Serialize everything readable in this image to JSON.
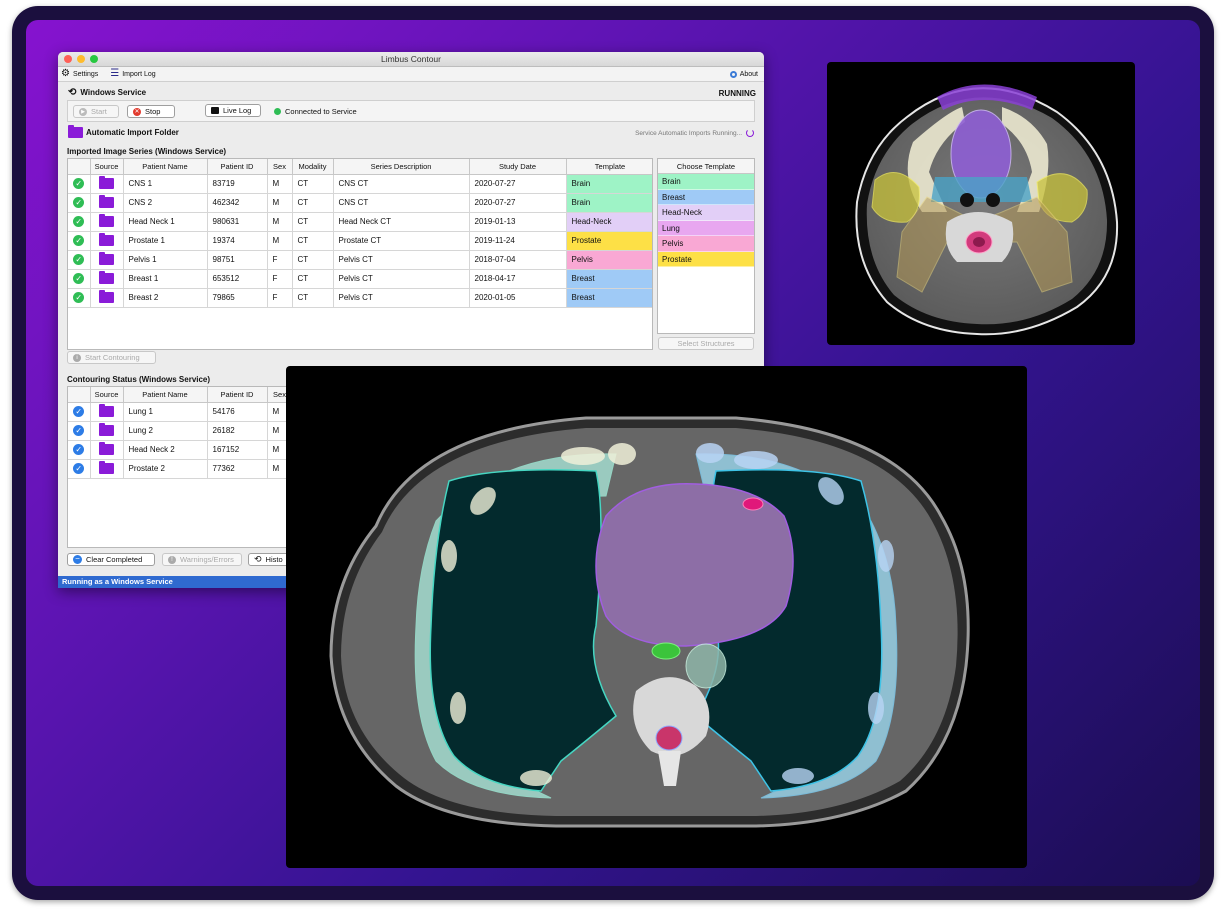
{
  "window": {
    "title": "Limbus Contour"
  },
  "menu": {
    "settings": "Settings",
    "import_log": "Import Log",
    "about": "About"
  },
  "service": {
    "heading": "Windows Service",
    "state": "RUNNING",
    "start_label": "Start",
    "stop_label": "Stop",
    "live_log_label": "Live Log",
    "connection_status": "Connected to Service"
  },
  "auto_import": {
    "label": "Automatic Import Folder",
    "status": "Service Automatic Imports Running..."
  },
  "imported": {
    "heading": "Imported Image Series (Windows Service)",
    "columns": [
      "Source",
      "Patient Name",
      "Patient ID",
      "Sex",
      "Modality",
      "Series Description",
      "Study Date",
      "Template"
    ],
    "rows": [
      {
        "name": "CNS 1",
        "id": "83719",
        "sex": "M",
        "modality": "CT",
        "desc": "CNS CT",
        "date": "2020-07-27",
        "template": "Brain",
        "color": "#9ef3c6"
      },
      {
        "name": "CNS 2",
        "id": "462342",
        "sex": "M",
        "modality": "CT",
        "desc": "CNS CT",
        "date": "2020-07-27",
        "template": "Brain",
        "color": "#9ef3c6"
      },
      {
        "name": "Head Neck 1",
        "id": "980631",
        "sex": "M",
        "modality": "CT",
        "desc": "Head Neck CT",
        "date": "2019-01-13",
        "template": "Head-Neck",
        "color": "#e2cff7"
      },
      {
        "name": "Prostate 1",
        "id": "19374",
        "sex": "M",
        "modality": "CT",
        "desc": "Prostate CT",
        "date": "2019-11-24",
        "template": "Prostate",
        "color": "#fde046"
      },
      {
        "name": "Pelvis 1",
        "id": "98751",
        "sex": "F",
        "modality": "CT",
        "desc": "Pelvis CT",
        "date": "2018-07-04",
        "template": "Pelvis",
        "color": "#f9a8d4"
      },
      {
        "name": "Breast 1",
        "id": "653512",
        "sex": "F",
        "modality": "CT",
        "desc": "Pelvis CT",
        "date": "2018-04-17",
        "template": "Breast",
        "color": "#9fcaf6"
      },
      {
        "name": "Breast 2",
        "id": "79865",
        "sex": "F",
        "modality": "CT",
        "desc": "Pelvis CT",
        "date": "2020-01-05",
        "template": "Breast",
        "color": "#9fcaf6"
      }
    ],
    "start_contouring_label": "Start Contouring"
  },
  "templates": {
    "heading": "Choose Template",
    "items": [
      {
        "label": "Brain",
        "color": "#9ef3c6"
      },
      {
        "label": "Breast",
        "color": "#9fcaf6"
      },
      {
        "label": "Head-Neck",
        "color": "#e2cff7"
      },
      {
        "label": "Lung",
        "color": "#e8a7f0"
      },
      {
        "label": "Pelvis",
        "color": "#f9a8d4"
      },
      {
        "label": "Prostate",
        "color": "#fde046"
      }
    ],
    "select_structures_label": "Select Structures"
  },
  "contouring": {
    "heading": "Contouring Status (Windows Service)",
    "columns": [
      "Source",
      "Patient Name",
      "Patient ID",
      "Sex"
    ],
    "rows": [
      {
        "name": "Lung 1",
        "id": "54176",
        "sex": "M"
      },
      {
        "name": "Lung 2",
        "id": "26182",
        "sex": "M"
      },
      {
        "name": "Head Neck 2",
        "id": "167152",
        "sex": "M"
      },
      {
        "name": "Prostate 2",
        "id": "77362",
        "sex": "M"
      }
    ],
    "clear_completed_label": "Clear Completed",
    "warnings_label": "Warnings/Errors",
    "history_label": "Histo"
  },
  "status_bar": {
    "text": "Running as a Windows Service"
  }
}
